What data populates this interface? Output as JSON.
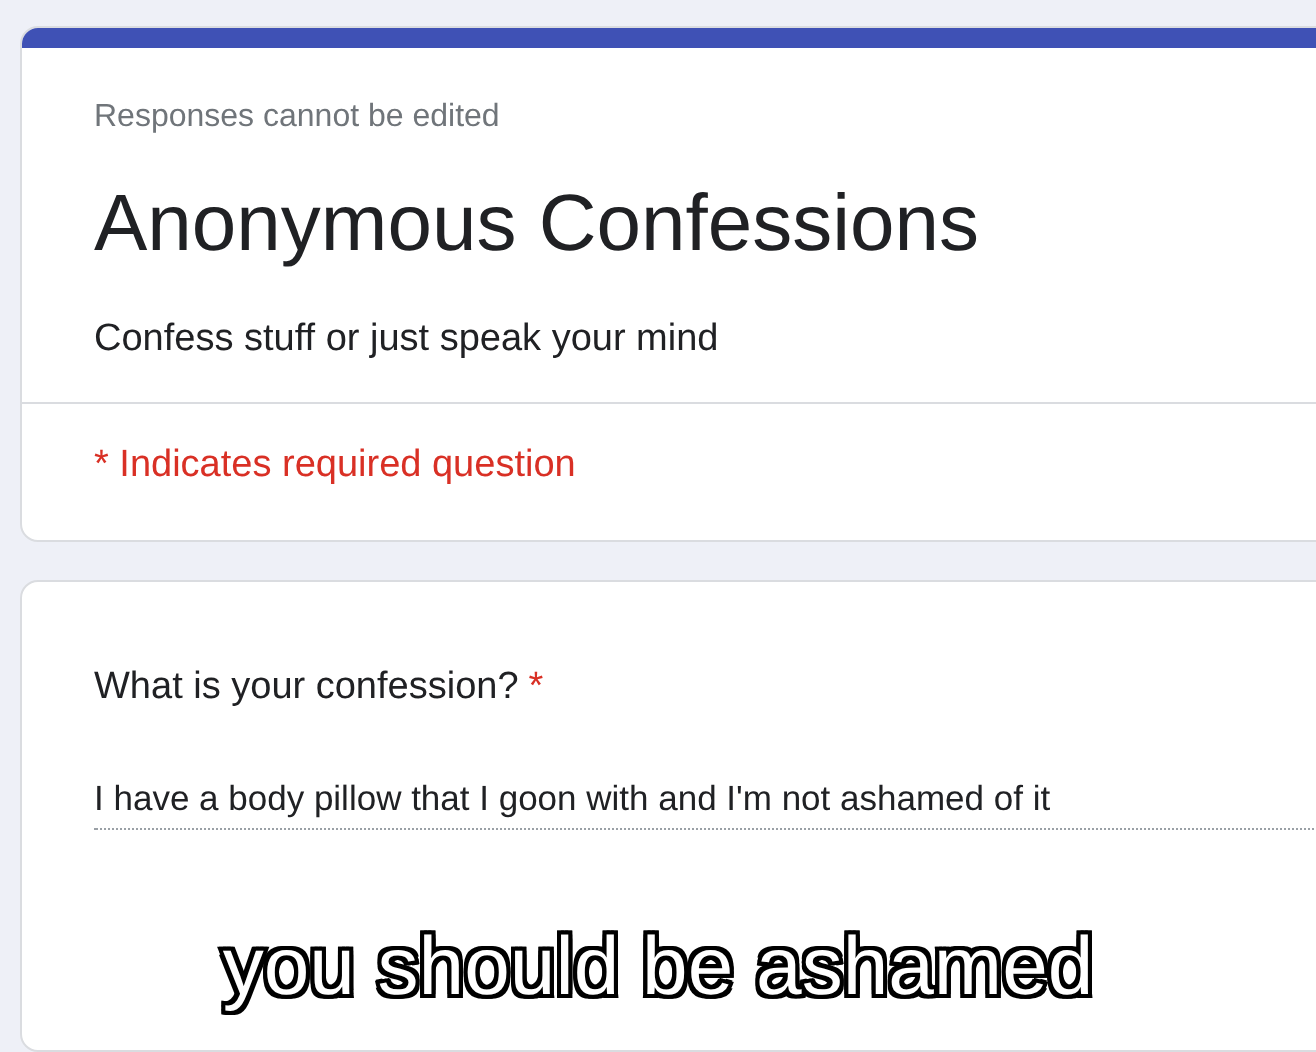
{
  "form": {
    "notice": "Responses cannot be edited",
    "title": "Anonymous Confessions",
    "description": "Confess stuff or just speak your mind",
    "required_note": "* Indicates required question"
  },
  "questions": [
    {
      "label": "What is your confession?",
      "required": true,
      "required_mark": "*",
      "answer": "I have a body pillow that I goon with and I'm not ashamed of it"
    }
  ],
  "caption": "you should be ashamed"
}
